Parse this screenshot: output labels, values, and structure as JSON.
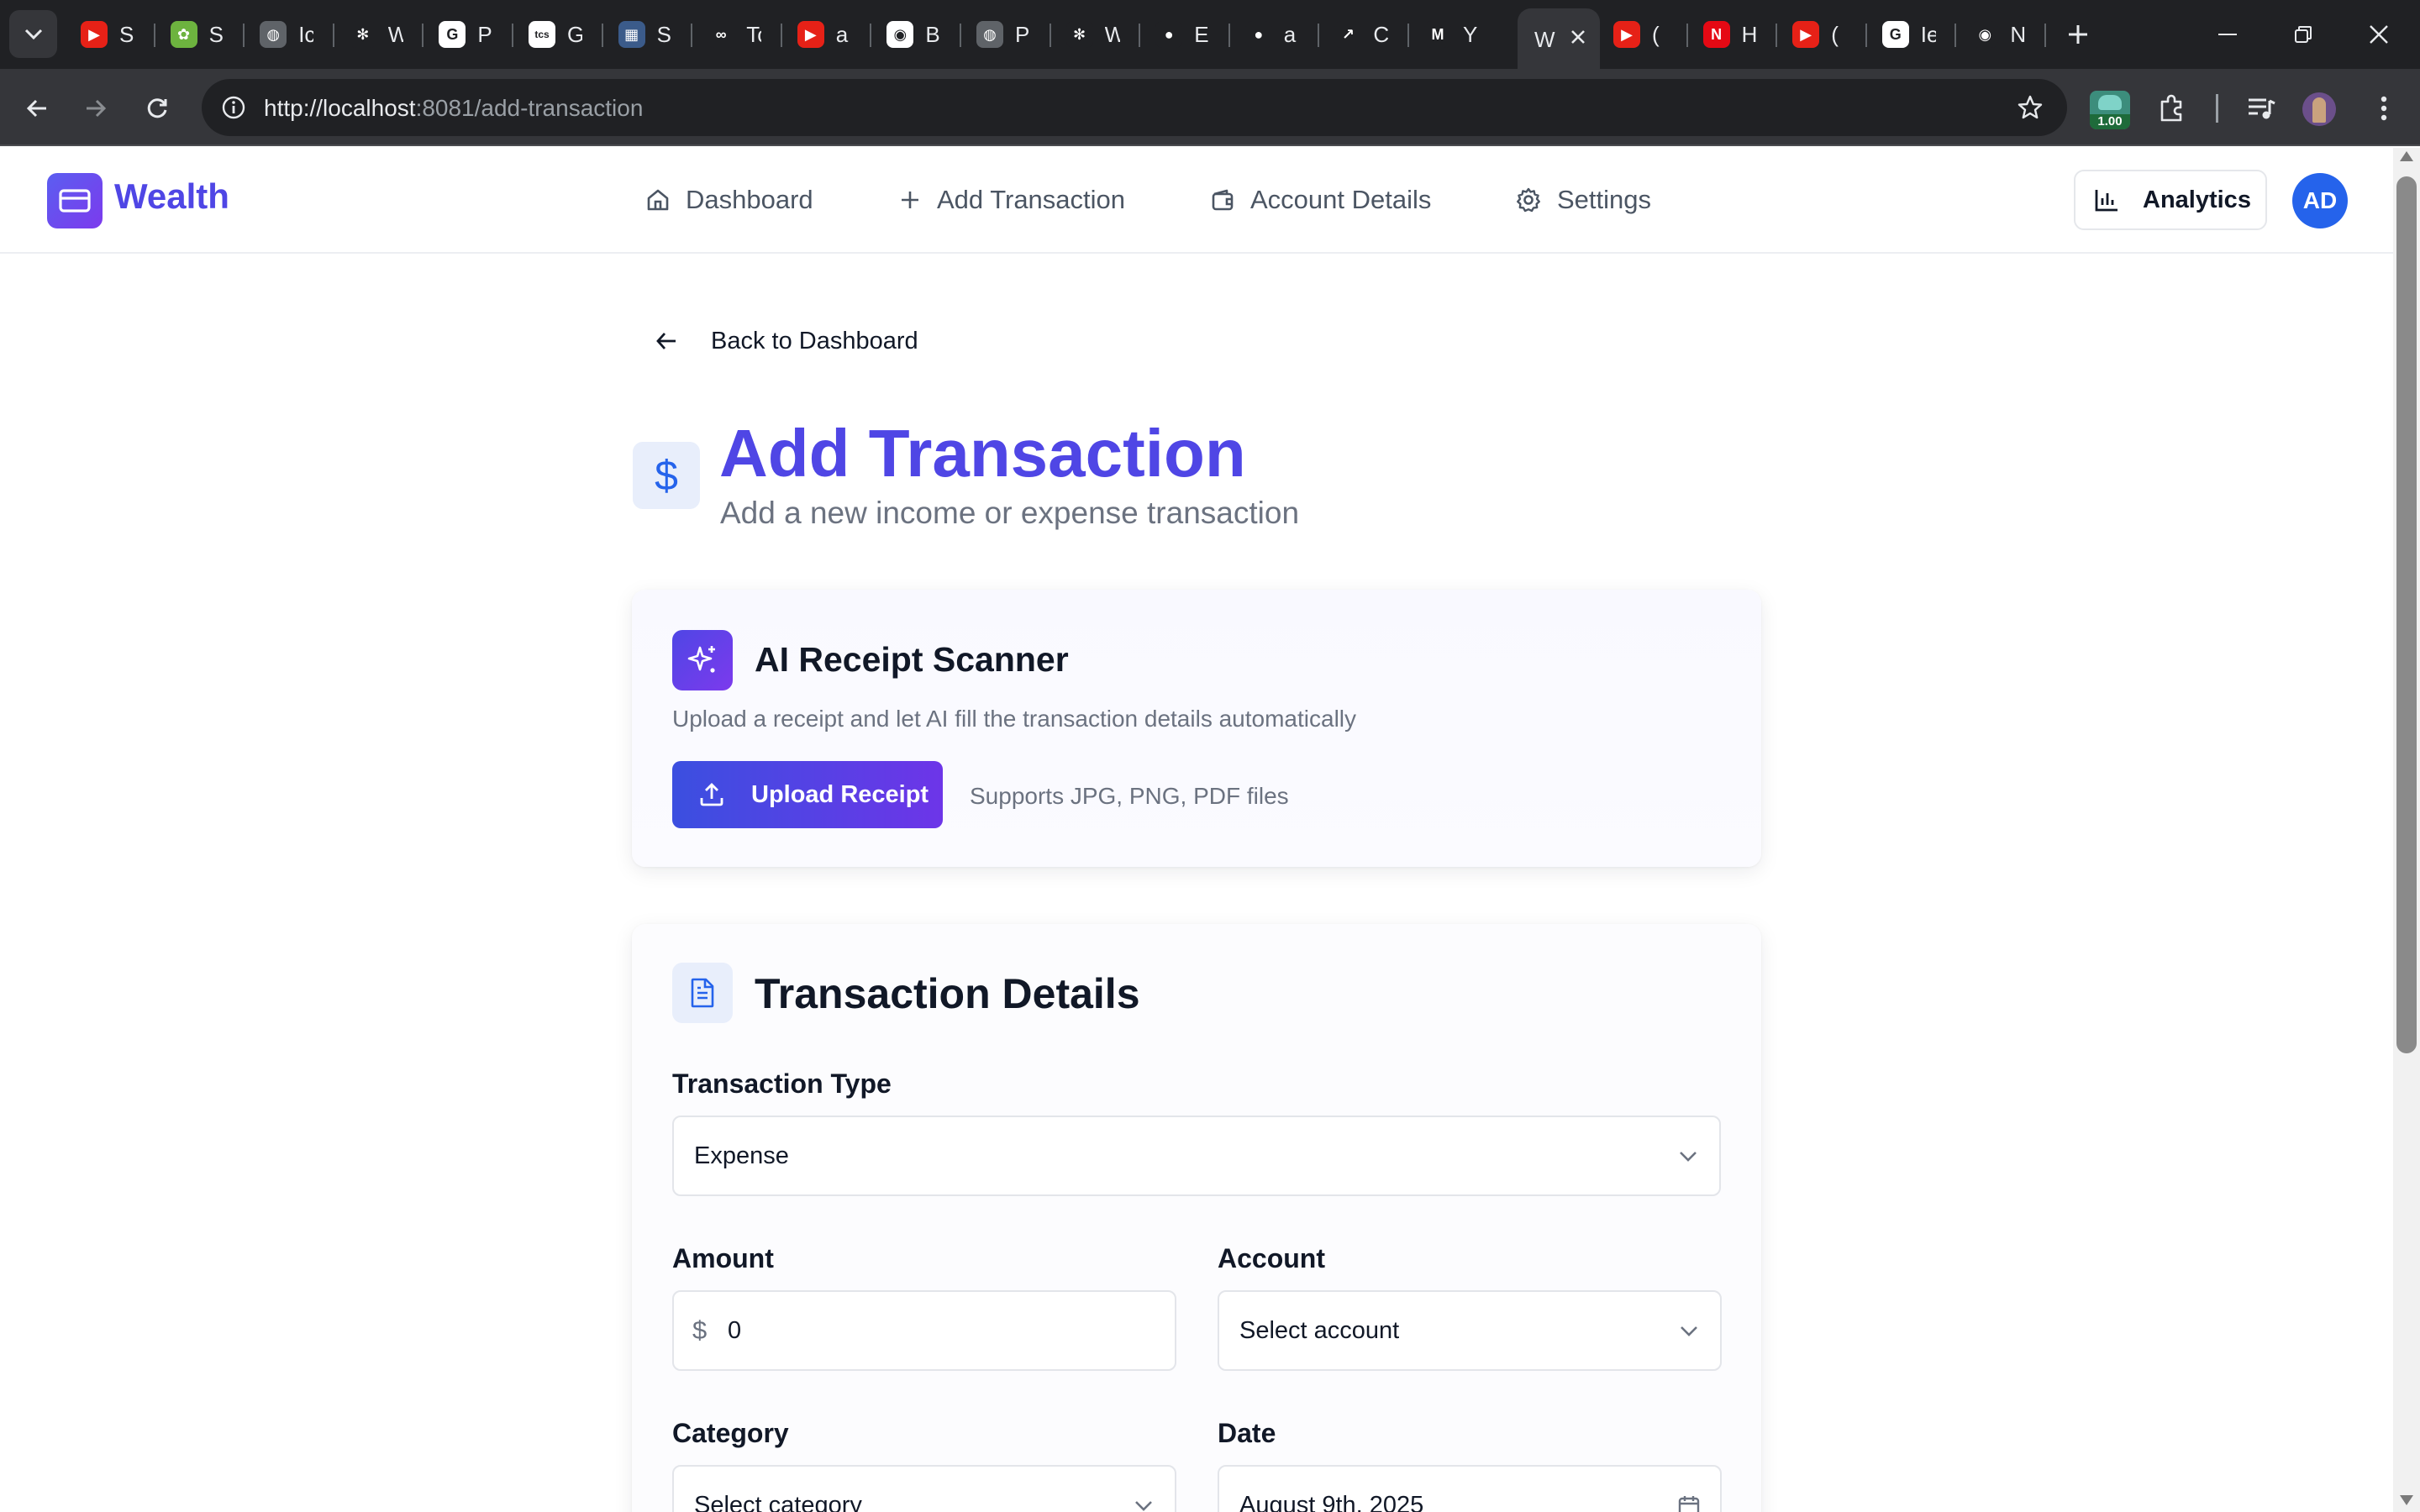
{
  "browser": {
    "tabs": [
      {
        "abbr": "S",
        "fav_color": "#e62117",
        "fav_glyph": "▶"
      },
      {
        "abbr": "S",
        "fav_color": "#6db33f",
        "fav_glyph": "✿"
      },
      {
        "abbr": "Ic",
        "fav_color": "#5f6368",
        "fav_glyph": "◍"
      },
      {
        "abbr": "W",
        "fav_color": "#202124",
        "fav_glyph": "✻"
      },
      {
        "abbr": "P",
        "fav_color": "#ffffff",
        "fav_glyph": "G"
      },
      {
        "abbr": "G",
        "fav_color": "#ffffff",
        "fav_glyph": "tcs"
      },
      {
        "abbr": "S",
        "fav_color": "#3b5b8a",
        "fav_glyph": "▦"
      },
      {
        "abbr": "Tc",
        "fav_color": "#202124",
        "fav_glyph": "∞"
      },
      {
        "abbr": "a",
        "fav_color": "#e62117",
        "fav_glyph": "▶"
      },
      {
        "abbr": "B",
        "fav_color": "#ffffff",
        "fav_glyph": "◉"
      },
      {
        "abbr": "P",
        "fav_color": "#5f6368",
        "fav_glyph": "◍"
      },
      {
        "abbr": "W",
        "fav_color": "#202124",
        "fav_glyph": "✻"
      },
      {
        "abbr": "E",
        "fav_color": "#202124",
        "fav_glyph": "●"
      },
      {
        "abbr": "a",
        "fav_color": "#202124",
        "fav_glyph": "●"
      },
      {
        "abbr": "C",
        "fav_color": "#202124",
        "fav_glyph": "↗"
      },
      {
        "abbr": "Y",
        "fav_color": "#202124",
        "fav_glyph": "M"
      }
    ],
    "active_tab": {
      "abbr": "W"
    },
    "tabs_after": [
      {
        "abbr": "(",
        "fav_color": "#e62117",
        "fav_glyph": "▶"
      },
      {
        "abbr": "H",
        "fav_color": "#e50914",
        "fav_glyph": "N"
      },
      {
        "abbr": "(",
        "fav_color": "#e62117",
        "fav_glyph": "▶"
      },
      {
        "abbr": "Ie",
        "fav_color": "#ffffff",
        "fav_glyph": "G"
      },
      {
        "abbr": "N",
        "fav_color": "#202124",
        "fav_glyph": "◉"
      }
    ],
    "url_host": "http://localhost",
    "url_rest": ":8081/add-transaction",
    "extension_badge": "1.00"
  },
  "header": {
    "brand": "Wealth",
    "nav": [
      {
        "label": "Dashboard",
        "icon": "home-icon"
      },
      {
        "label": "Add Transaction",
        "icon": "plus-icon"
      },
      {
        "label": "Account Details",
        "icon": "wallet-icon"
      },
      {
        "label": "Settings",
        "icon": "gear-icon"
      }
    ],
    "analytics_label": "Analytics",
    "avatar_initials": "AD"
  },
  "page": {
    "back_label": "Back to Dashboard",
    "title": "Add Transaction",
    "subtitle": "Add a new income or expense transaction",
    "title_icon_glyph": "$"
  },
  "ai_scanner": {
    "title": "AI Receipt Scanner",
    "description": "Upload a receipt and let AI fill the transaction details automatically",
    "upload_label": "Upload Receipt",
    "hint": "Supports JPG, PNG, PDF files"
  },
  "transaction": {
    "title": "Transaction Details",
    "type_label": "Transaction Type",
    "type_value": "Expense",
    "amount_label": "Amount",
    "amount_prefix": "$",
    "amount_value": "0",
    "account_label": "Account",
    "account_value": "Select account",
    "category_label": "Category",
    "category_value": "Select category",
    "date_label": "Date",
    "date_value": "August 9th, 2025"
  },
  "colors": {
    "brand": "#4f46e5",
    "accent_gradient_start": "#3b4fe0",
    "accent_gradient_end": "#6d35e8",
    "avatar": "#2563eb"
  }
}
